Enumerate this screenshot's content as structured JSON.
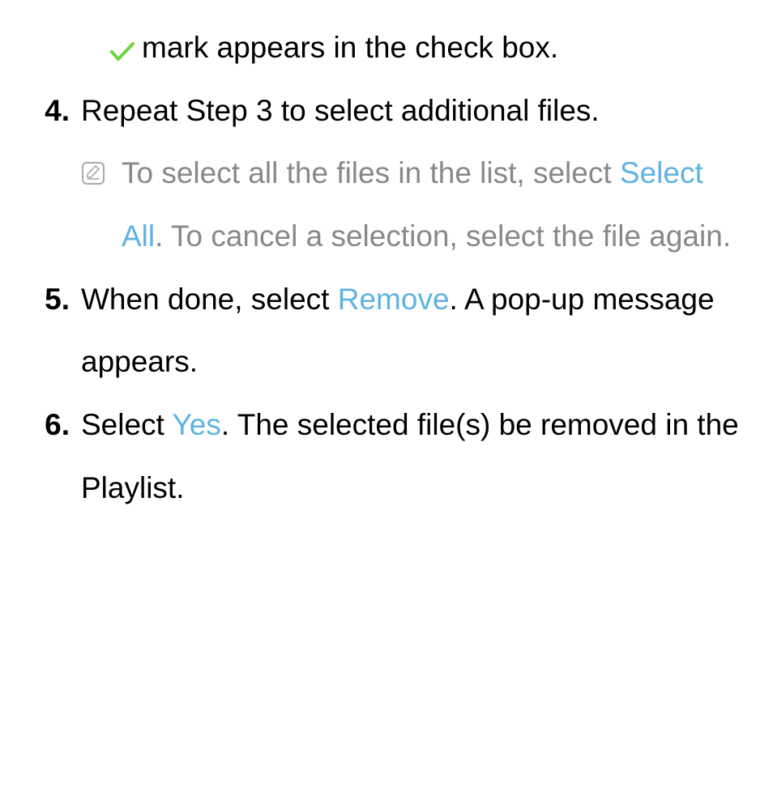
{
  "step3_tail": {
    "text": "mark appears in the check box."
  },
  "step4": {
    "num": "4.",
    "text": "Repeat Step 3 to select additional files."
  },
  "note": {
    "pre": "To select all the files in the list, select ",
    "highlight": "Select All",
    "post": ". To cancel a selection, select the file again."
  },
  "step5": {
    "num": "5.",
    "pre": "When done, select ",
    "highlight": "Remove",
    "post": ". A pop-up message appears."
  },
  "step6": {
    "num": "6.",
    "pre": "Select ",
    "highlight": "Yes",
    "post": ". The selected file(s) be removed in the Playlist."
  }
}
